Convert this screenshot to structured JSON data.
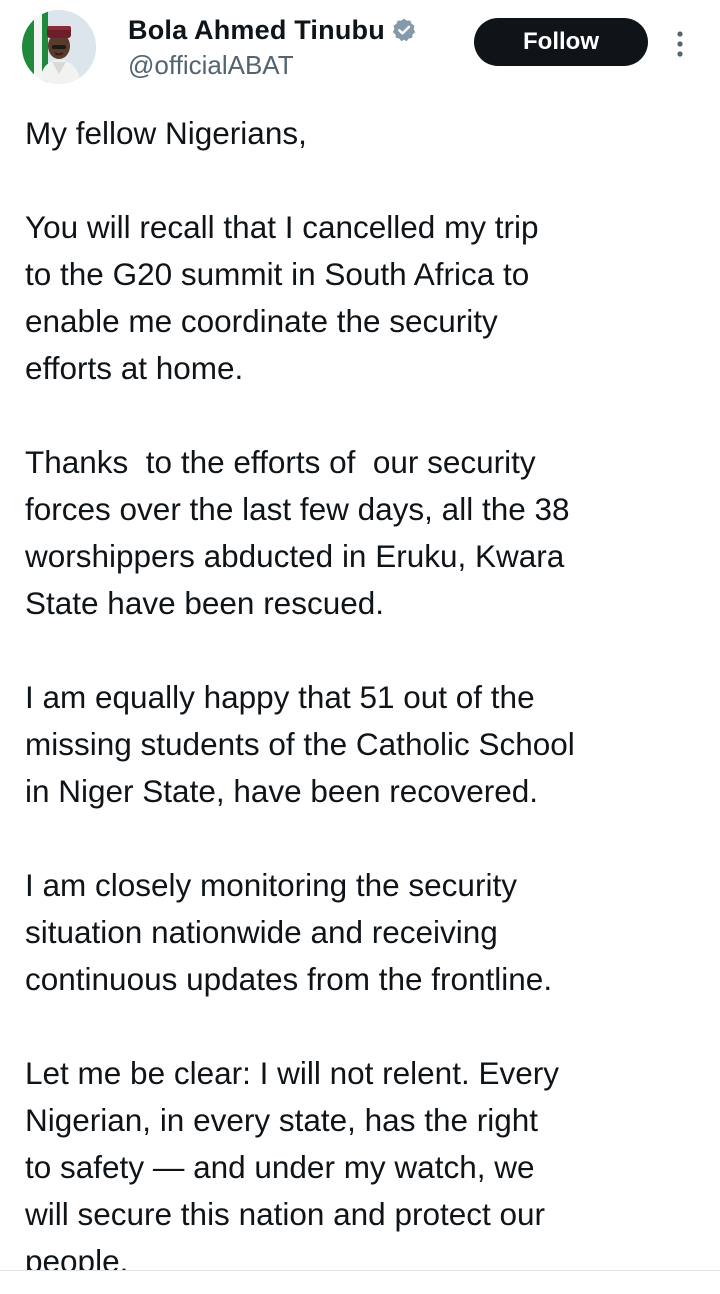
{
  "author": {
    "display_name": "Bola Ahmed Tinubu",
    "handle": "@officialABAT",
    "verified_icon": "verified-badge-icon",
    "avatar_icon": "profile-avatar"
  },
  "actions": {
    "follow_label": "Follow",
    "more_icon": "vertical-ellipsis-icon"
  },
  "colors": {
    "text_primary": "#0f1419",
    "text_secondary": "#536471",
    "follow_bg": "#0f1419",
    "verified": "#829aab"
  },
  "post": {
    "paragraphs": [
      {
        "lines": [
          "My fellow Nigerians,"
        ]
      },
      {
        "lines": [
          "You will recall that I cancelled my trip",
          "to the G20 summit in South Africa to",
          "enable me coordinate the security",
          "efforts at home."
        ]
      },
      {
        "lines": [
          "Thanks  to the efforts of  our security",
          "forces over the last few days, all the 38",
          "worshippers abducted in Eruku, Kwara",
          "State have been rescued."
        ]
      },
      {
        "lines": [
          "I am equally happy that 51 out of the",
          "missing students of the Catholic School",
          "in Niger State, have been recovered."
        ]
      },
      {
        "lines": [
          "I am closely monitoring the security",
          "situation nationwide and receiving",
          "continuous updates from the frontline."
        ]
      },
      {
        "lines": [
          "Let me be clear: I will not relent. Every",
          "Nigerian, in every state, has the right",
          "to safety — and under my watch, we",
          "will secure this nation and protect our",
          "people."
        ]
      }
    ]
  }
}
